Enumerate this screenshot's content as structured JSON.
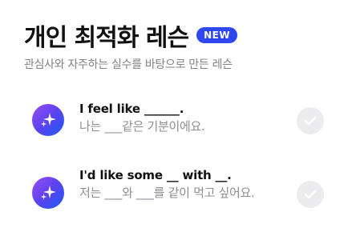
{
  "header": {
    "title": "개인 최적화 레슨",
    "badge": "NEW",
    "subtitle": "관심사와 자주하는 실수를 바탕으로 만든 레슨"
  },
  "lessons": [
    {
      "english": "I feel like ______.",
      "korean": "나는 ___같은 기분이에요.",
      "icon": "sparkle-icon",
      "status_icon": "check-icon"
    },
    {
      "english": "I'd like some __ with __.",
      "korean": "저는 ___와 ___를 같이 먹고 싶어요.",
      "icon": "sparkle-icon",
      "status_icon": "check-icon"
    }
  ],
  "colors": {
    "badge": "#2f47ee",
    "icon_gradient_start": "#9b4df2",
    "icon_gradient_end": "#1e5cf6",
    "check_background": "#ececee"
  }
}
